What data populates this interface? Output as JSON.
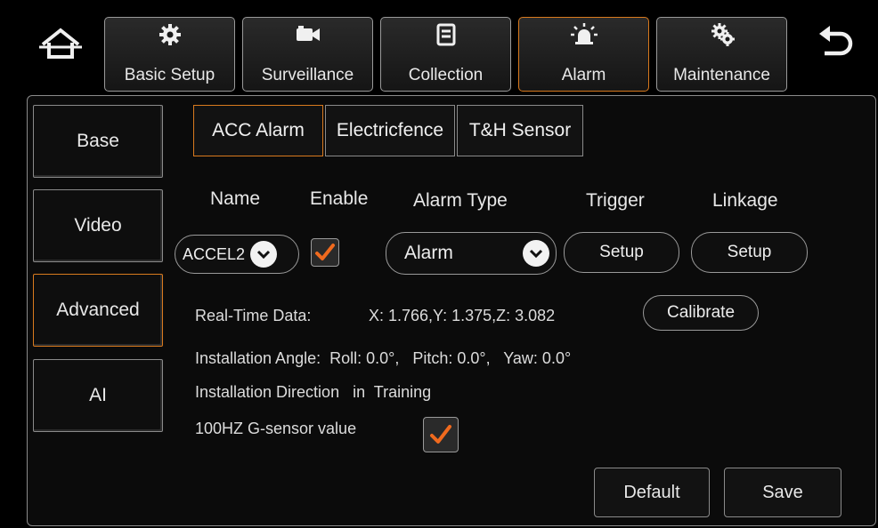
{
  "nav": {
    "tabs": [
      {
        "label": "Basic Setup",
        "icon": "gear-icon"
      },
      {
        "label": "Surveillance",
        "icon": "camera-icon"
      },
      {
        "label": "Collection",
        "icon": "storage-icon"
      },
      {
        "label": "Alarm",
        "icon": "alarm-light-icon"
      },
      {
        "label": "Maintenance",
        "icon": "gears-icon"
      }
    ],
    "active": "Alarm"
  },
  "sidebar": {
    "items": [
      {
        "label": "Base"
      },
      {
        "label": "Video"
      },
      {
        "label": "Advanced"
      },
      {
        "label": "AI"
      }
    ],
    "active": "Advanced"
  },
  "subtabs": {
    "items": [
      {
        "label": "ACC Alarm"
      },
      {
        "label": "Electricfence"
      },
      {
        "label": "T&H Sensor"
      }
    ],
    "active": "ACC Alarm"
  },
  "table": {
    "headers": {
      "name": "Name",
      "enable": "Enable",
      "alarm_type": "Alarm Type",
      "trigger": "Trigger",
      "linkage": "Linkage"
    },
    "row": {
      "name": "ACCEL2",
      "enabled": true,
      "alarm_type": "Alarm",
      "trigger_label": "Setup",
      "linkage_label": "Setup"
    }
  },
  "realtime": {
    "label": "Real-Time Data:",
    "value": "X: 1.766,Y: 1.375,Z: 3.082",
    "calibrate_label": "Calibrate"
  },
  "installation_angle": {
    "text": "Installation Angle:  Roll: 0.0°,   Pitch: 0.0°,   Yaw: 0.0°"
  },
  "installation_direction": {
    "text": "Installation Direction   in  Training"
  },
  "gsensor": {
    "label": "100HZ G-sensor value",
    "checked": true
  },
  "footer": {
    "default_label": "Default",
    "save_label": "Save"
  },
  "colors": {
    "accent": "#d97a1e",
    "check": "#f06a1e",
    "background": "#000000"
  }
}
